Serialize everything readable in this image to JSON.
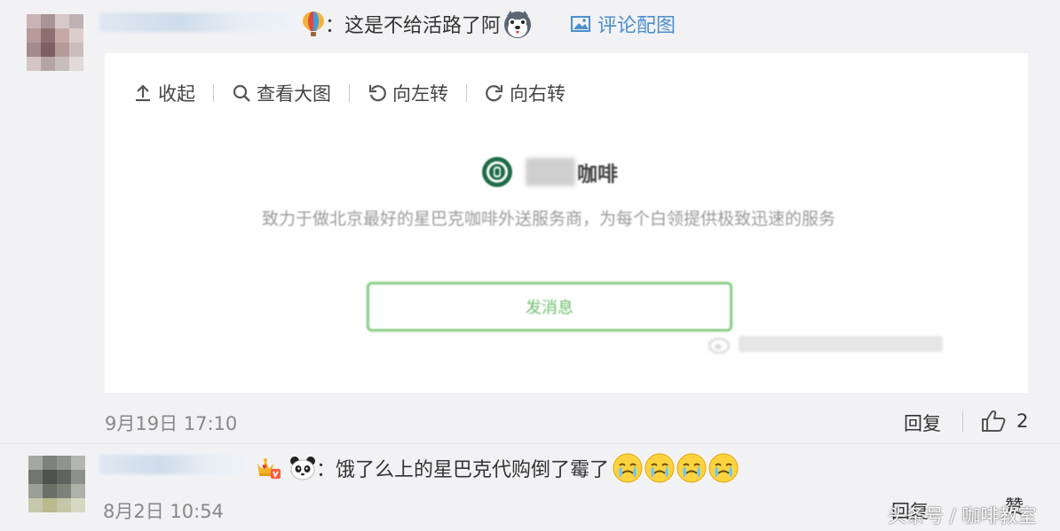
{
  "comment1": {
    "text": "：这是不给活路了阿",
    "image_link_label": "评论配图",
    "toolbar": {
      "collapse": "收起",
      "view_large": "查看大图",
      "rotate_left": "向左转",
      "rotate_right": "向右转"
    },
    "image": {
      "brand_suffix": "咖啡",
      "slogan": "致力于做北京最好的星巴克咖啡外送服务商，为每个白领提供极致迅速的服务",
      "button_label": "发消息"
    },
    "date": "9月19日 17:10",
    "reply_label": "回复",
    "like_count": "2"
  },
  "comment2": {
    "text": "：饿了么上的星巴克代购倒了霉了",
    "date": "8月2日 10:54",
    "reply_label": "回复",
    "like_label": "赞"
  },
  "watermark": {
    "text": "头条号 / 咖啡教室"
  },
  "colors": {
    "background": "#f2f2f5",
    "link_blue": "#4a8fcc",
    "button_green": "#8ccf8a",
    "starbucks_green": "#1e6b45"
  }
}
